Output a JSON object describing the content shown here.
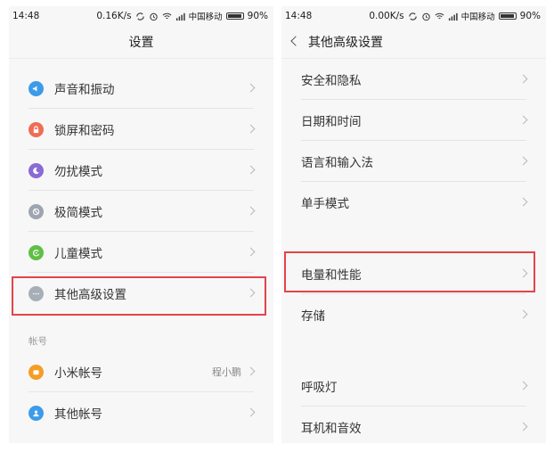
{
  "left": {
    "status": {
      "time": "14:48",
      "speed": "0.16K/s",
      "carrier": "中国移动",
      "battery": "90%"
    },
    "title": "设置",
    "items": [
      {
        "label": "声音和振动",
        "icon": "sound-icon",
        "color": "#3d9be9"
      },
      {
        "label": "锁屏和密码",
        "icon": "lock-icon",
        "color": "#ef6c55"
      },
      {
        "label": "勿扰模式",
        "icon": "moon-icon",
        "color": "#8a6ad6"
      },
      {
        "label": "极简模式",
        "icon": "minimal-mode-icon",
        "color": "#9ea5b0"
      },
      {
        "label": "儿童模式",
        "icon": "child-mode-icon",
        "color": "#5fbf45"
      },
      {
        "label": "其他高级设置",
        "icon": "more-icon",
        "color": "#a8aeb8"
      }
    ],
    "account_header": "帐号",
    "accounts": [
      {
        "label": "小米帐号",
        "icon": "mi-account-icon",
        "color": "#f59d24",
        "value": "程小鹏"
      },
      {
        "label": "其他帐号",
        "icon": "user-icon",
        "color": "#3d9be9"
      }
    ]
  },
  "right": {
    "status": {
      "time": "14:48",
      "speed": "0.00K/s",
      "carrier": "中国移动",
      "battery": "90%"
    },
    "title": "其他高级设置",
    "group1": [
      "安全和隐私",
      "日期和时间",
      "语言和输入法",
      "单手模式"
    ],
    "group2": [
      "电量和性能",
      "存储"
    ],
    "group3": [
      "呼吸灯",
      "耳机和音效"
    ]
  },
  "colors": {
    "highlight": "#e2444b"
  }
}
